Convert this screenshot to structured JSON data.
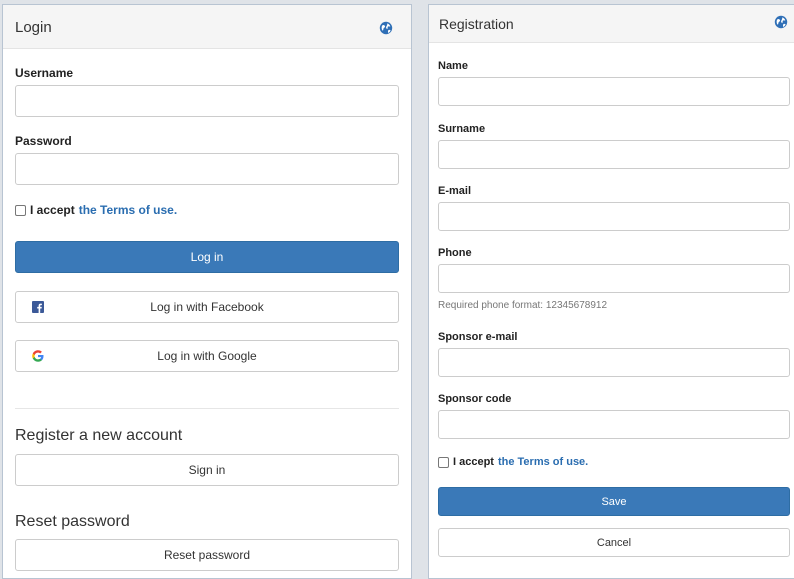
{
  "login": {
    "title": "Login",
    "username_label": "Username",
    "username_value": "",
    "password_label": "Password",
    "password_value": "",
    "accept_prefix": "I accept",
    "accept_link": "the Terms of use.",
    "login_button": "Log in",
    "facebook_button": "Log in with Facebook",
    "google_button": "Log in with Google",
    "register_title": "Register a new account",
    "signin_button": "Sign in",
    "reset_title": "Reset password",
    "reset_button": "Reset password"
  },
  "registration": {
    "title": "Registration",
    "name_label": "Name",
    "surname_label": "Surname",
    "email_label": "E-mail",
    "phone_label": "Phone",
    "phone_help": "Required phone format: 12345678912",
    "sponsor_email_label": "Sponsor e-mail",
    "sponsor_code_label": "Sponsor code",
    "accept_prefix": "I accept",
    "accept_link": "the Terms of use.",
    "save_button": "Save",
    "cancel_button": "Cancel"
  },
  "colors": {
    "primary": "#3a79b8",
    "link": "#2a6db0",
    "globe": "#2f6fb6"
  },
  "icons": {
    "globe": "globe-icon",
    "facebook": "facebook-icon",
    "google": "google-icon"
  }
}
